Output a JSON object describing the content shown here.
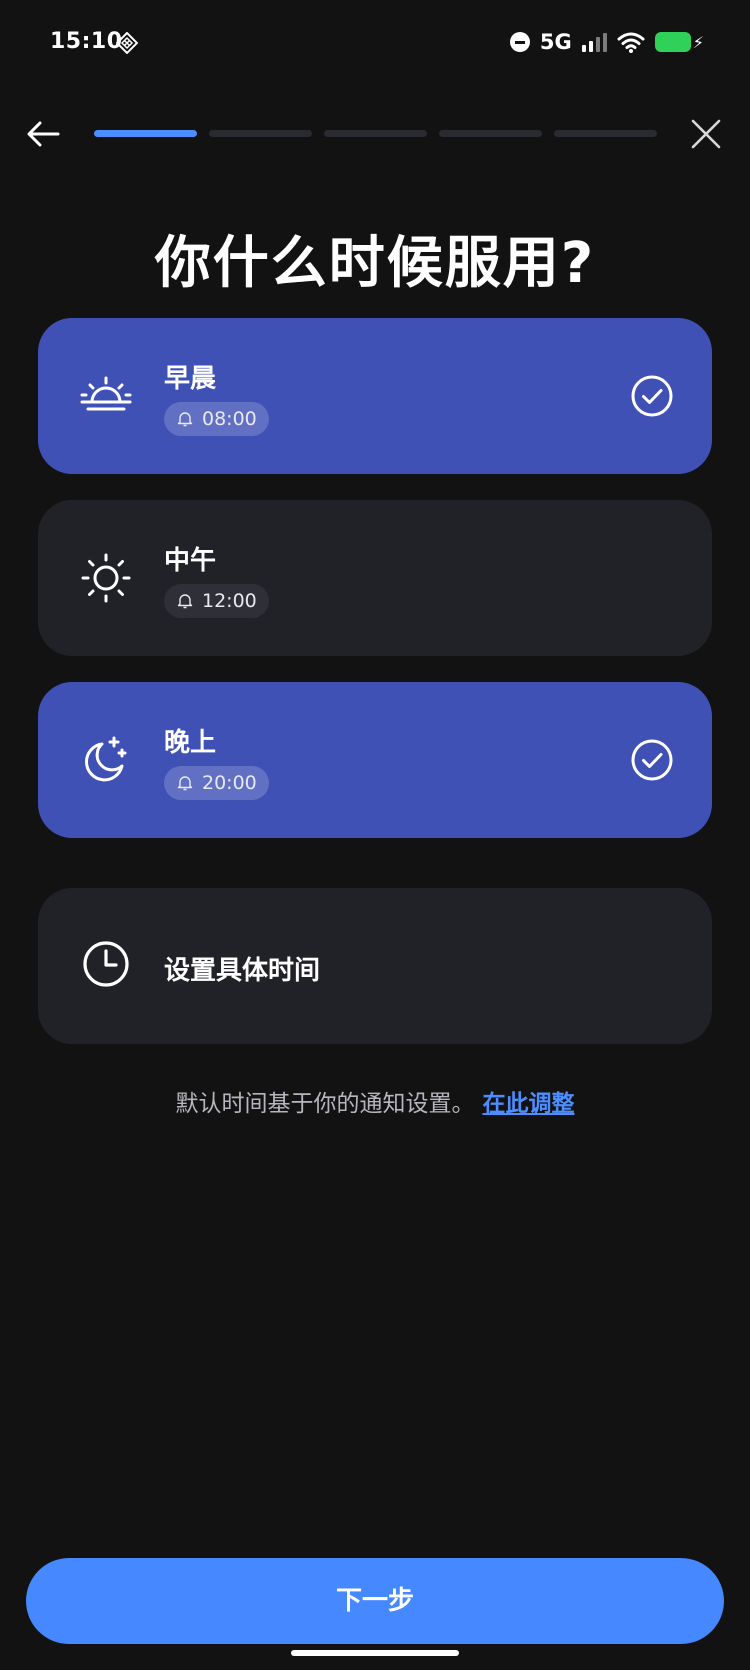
{
  "status_bar": {
    "time": "15:10",
    "network": "5G",
    "icons": [
      "diamond-grid-icon",
      "do-not-disturb-icon",
      "signal-icon",
      "wifi-icon",
      "battery-charging-icon"
    ],
    "battery_color": "#30d158"
  },
  "header": {
    "back_icon": "arrow-left-icon",
    "close_icon": "close-icon",
    "progress": {
      "total_steps": 5,
      "current_step": 1
    }
  },
  "title": "你什么时候服用?",
  "options": [
    {
      "label": "早晨",
      "time": "08:00",
      "icon": "sunrise-icon",
      "selected": true
    },
    {
      "label": "中午",
      "time": "12:00",
      "icon": "sun-icon",
      "selected": false
    },
    {
      "label": "晚上",
      "time": "20:00",
      "icon": "moon-stars-icon",
      "selected": true
    },
    {
      "label": "设置具体时间",
      "icon": "clock-icon",
      "selected": false
    }
  ],
  "note": {
    "text": "默认时间基于你的通知设置。",
    "link": "在此调整"
  },
  "next_button": "下一步",
  "colors": {
    "background": "#121212",
    "card": "#212128",
    "card_selected": "#3f51b5",
    "accent": "#4588ff",
    "link": "#4c8dff"
  }
}
